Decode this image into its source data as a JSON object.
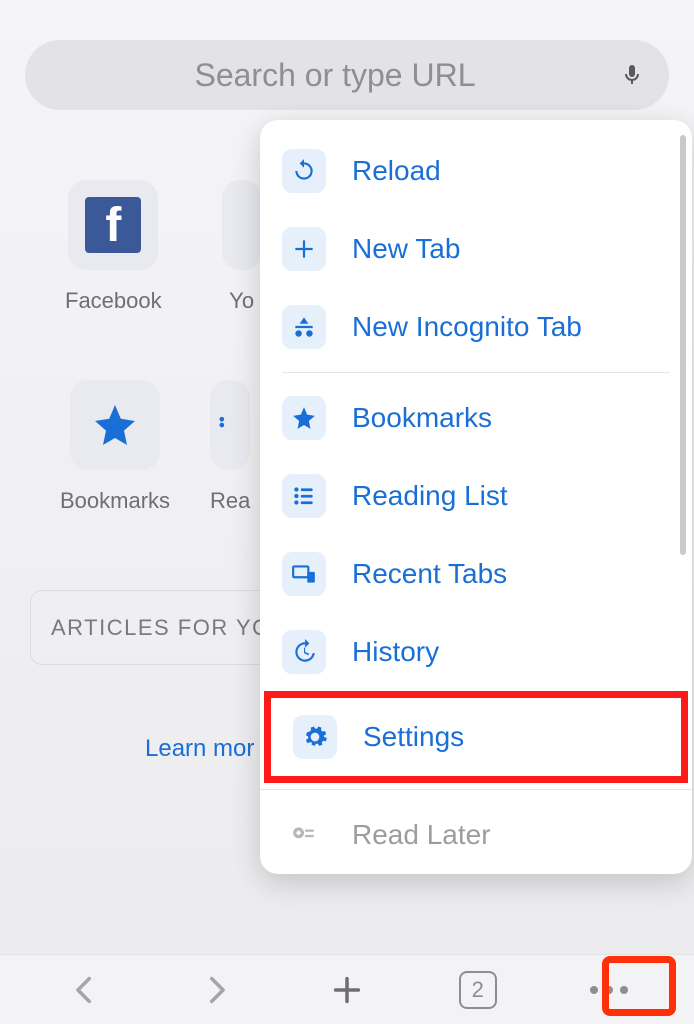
{
  "search": {
    "placeholder": "Search or type URL"
  },
  "shortcuts": {
    "row1": [
      {
        "label": "Facebook"
      },
      {
        "label": "Yo"
      }
    ],
    "row2": [
      {
        "label": "Bookmarks"
      },
      {
        "label": "Rea"
      }
    ]
  },
  "articles": {
    "heading": "ARTICLES FOR YO"
  },
  "learn_more": "Learn mor",
  "menu": {
    "items": [
      {
        "label": "Reload"
      },
      {
        "label": "New Tab"
      },
      {
        "label": "New Incognito Tab"
      },
      {
        "label": "Bookmarks"
      },
      {
        "label": "Reading List"
      },
      {
        "label": "Recent Tabs"
      },
      {
        "label": "History"
      },
      {
        "label": "Settings"
      },
      {
        "label": "Read Later"
      }
    ]
  },
  "bottom": {
    "tab_count": "2"
  }
}
